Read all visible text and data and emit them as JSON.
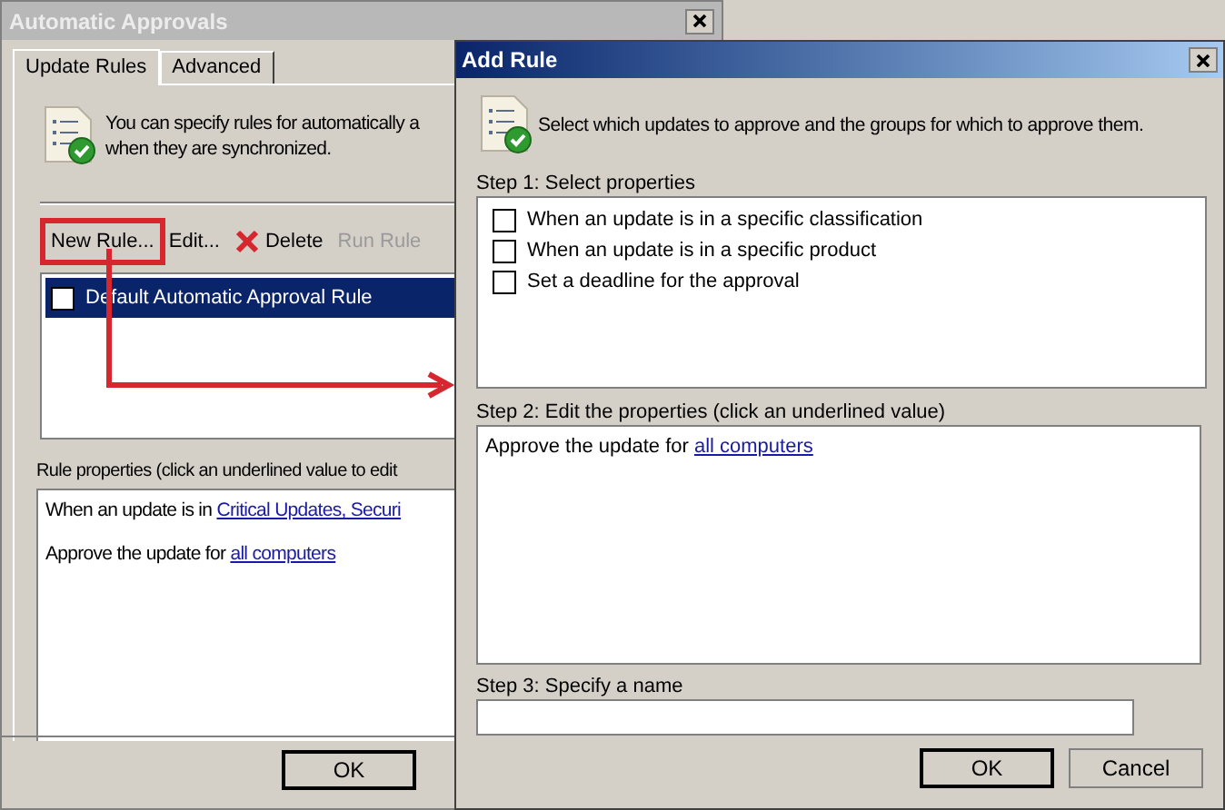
{
  "main_window": {
    "title": "Automatic Approvals",
    "tabs": [
      {
        "label": "Update Rules",
        "selected": true
      },
      {
        "label": "Advanced",
        "selected": false
      }
    ],
    "intro": [
      "You can specify rules for automatically a",
      "when they are synchronized."
    ],
    "toolbar": [
      {
        "label": "New Rule...",
        "kind": "plain",
        "disabled": false,
        "highlighted": true
      },
      {
        "label": "Edit...",
        "kind": "plain",
        "disabled": false,
        "highlighted": false
      },
      {
        "label": "Delete",
        "kind": "delete",
        "disabled": false,
        "highlighted": false
      },
      {
        "label": "Run Rule",
        "kind": "plain",
        "disabled": true,
        "highlighted": false
      }
    ],
    "rules": [
      {
        "name": "Default Automatic Approval Rule",
        "checked": false,
        "selected": true
      }
    ],
    "properties_label": "Rule properties (click an underlined value to edit",
    "properties": [
      {
        "text": "When an update is in",
        "link": "Critical Updates, Securi"
      },
      {
        "text": "Approve the update for",
        "link": "all computers"
      }
    ],
    "buttons": [
      "OK"
    ]
  },
  "dialog": {
    "title": "Add Rule",
    "intro": "Select which updates to approve and the groups for which to approve them.",
    "step1_label": "Step 1: Select properties",
    "options": [
      {
        "label": "When an update is in a specific classification",
        "checked": false
      },
      {
        "label": "When an update is in a specific product",
        "checked": false
      },
      {
        "label": "Set a deadline for the approval",
        "checked": false
      }
    ],
    "step2_label": "Step 2: Edit the properties (click an underlined value)",
    "properties": [
      {
        "text": "Approve the update for",
        "link": "all computers"
      }
    ],
    "step3_label": "Step 3: Specify a name",
    "buttons": [
      "OK",
      "Cancel"
    ]
  }
}
